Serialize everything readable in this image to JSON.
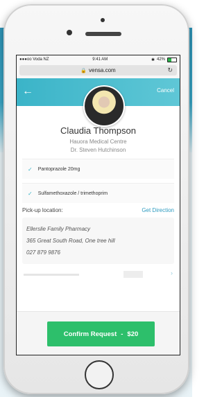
{
  "status": {
    "carrier": "●●●oo Voda NZ",
    "time": "9:41 AM",
    "battery": "42%"
  },
  "browser": {
    "url": "vensa.com",
    "lock_icon": "lock-icon",
    "reload_icon": "reload-icon"
  },
  "header": {
    "back_icon": "arrow-left-icon",
    "cancel": "Cancel",
    "accent": "#3bb4c8"
  },
  "profile": {
    "name": "Claudia Thompson",
    "clinic": "Hauora Medical Centre",
    "doctor": "Dr. Steven Hutchinson"
  },
  "medications": [
    {
      "label": "Pantoprazole 20mg"
    },
    {
      "label": "Sulfamethoxazole / trimethoprim"
    }
  ],
  "pickup": {
    "label": "Pick-up location:",
    "direction": "Get Direction"
  },
  "pharmacy": {
    "name": "Ellerslie Family Pharmacy",
    "address": "365 Great South Road, One tree hill",
    "phone": "027 879 9876"
  },
  "confirm": {
    "label": "Confirm Request",
    "separator": "-",
    "price": "$20",
    "color": "#2dbf6b"
  }
}
